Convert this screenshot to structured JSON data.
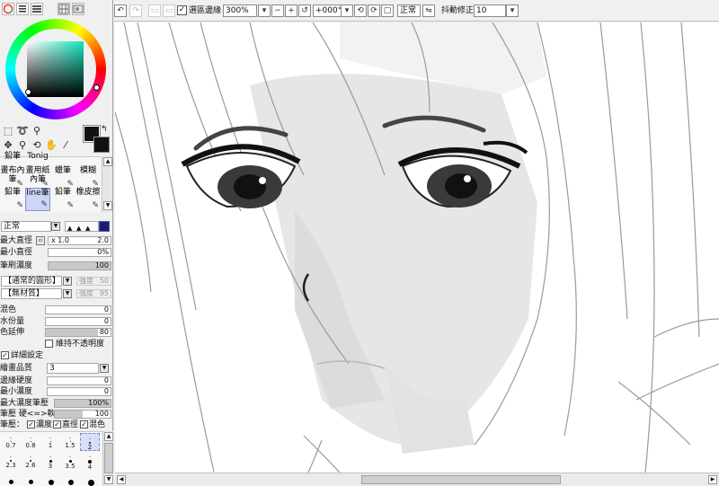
{
  "panel_tabs": [
    "color-wheel-icon",
    "color-sliders-icon",
    "list-icon",
    "grid-swatch-icon",
    "image-icon"
  ],
  "colors": {
    "foreground": "#111111",
    "background": "#111111",
    "hue_accent": "#14e6c0"
  },
  "tools": [
    "rect-select-icon",
    "lasso-icon",
    "magic-wand-icon",
    "move-icon",
    "zoom-icon",
    "rotate-icon",
    "hand-icon",
    "eyedropper-icon"
  ],
  "brushes": [
    [
      "鉛筆",
      "Tonig",
      "",
      ""
    ],
    [
      "畫布內筆",
      "畫用紙內筆",
      "蠟筆",
      "模糊"
    ],
    [
      "鉛筆",
      "line筆",
      "鉛筆",
      "橡皮擦"
    ]
  ],
  "brush_selected": "line筆",
  "blend_mode": "正常",
  "settings": {
    "max_size_label": "最大直徑",
    "max_size_mult": "x 1.0",
    "max_size_value": "2.0",
    "min_size_label": "最小直徑",
    "min_size_value": "0%",
    "density_label": "筆刷濃度",
    "density_value": "100",
    "shape_select": "【通常的圓形】",
    "shape_strength_label": "強度",
    "shape_strength_value": "50",
    "texture_select": "【無材質】",
    "texture_strength_label": "強度",
    "texture_strength_value": "95",
    "blend_label": "混色",
    "blend_value": "0",
    "water_label": "水份量",
    "water_value": "0",
    "persistence_label": "色延伸",
    "persistence_value": "80",
    "keep_opacity_label": "維持不透明度",
    "advanced_label": "詳細設定",
    "quality_label": "繪畫品質",
    "quality_value": "3",
    "edge_label": "邊緣硬度",
    "edge_value": "0",
    "min_density_label": "最小濃度",
    "min_density_value": "0",
    "max_density_pressure_label": "最大濃度筆壓",
    "max_density_pressure_value": "100%",
    "pressure_hard_label": "筆壓 硬<=>軟",
    "pressure_hard_value": "100",
    "pressure_label": "筆壓：",
    "pressure_density": "濃度",
    "pressure_size": "直徑",
    "pressure_blend": "混色"
  },
  "brush_sizes": [
    [
      ".",
      ".",
      ".",
      ".",
      "."
    ],
    [
      "0.7",
      "0.8",
      "1",
      "1.5",
      "2"
    ],
    [
      ".",
      ".",
      ".",
      ".",
      "."
    ],
    [
      "2.3",
      "2.6",
      "3",
      "3.5",
      "4"
    ]
  ],
  "brush_size_selected": "2",
  "toolbar": {
    "selection_edge_label": "選區邊緣",
    "zoom_value": "300%",
    "rotation_value": "+000°",
    "mode_value": "正常",
    "stabilizer_label": "抖動修正",
    "stabilizer_value": "10"
  },
  "progress": {
    "density": 1.0,
    "persistence": 0.8,
    "max_density_pressure": 1.0,
    "pressure_hard": 0.5,
    "scroll_position": 0.44
  }
}
